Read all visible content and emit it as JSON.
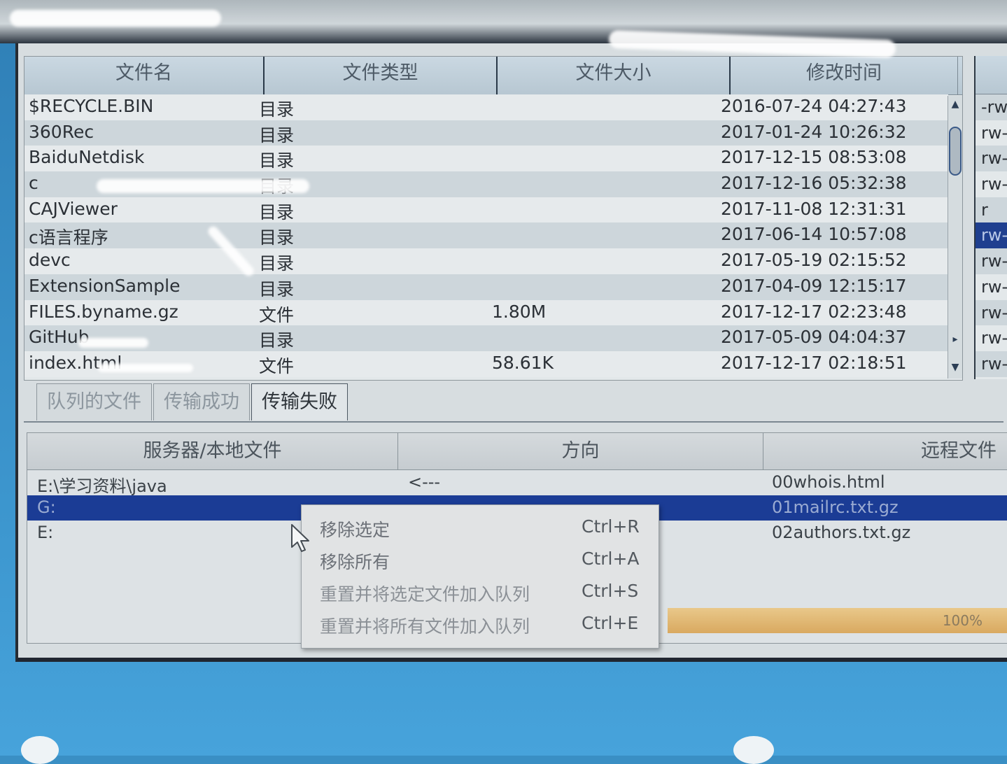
{
  "file_list": {
    "headers": [
      "文件名",
      "文件类型",
      "文件大小",
      "修改时间"
    ],
    "rows": [
      {
        "name": "$RECYCLE.BIN",
        "type": "目录",
        "size": "",
        "time": "2016-07-24  04:27:43"
      },
      {
        "name": "360Rec",
        "type": "目录",
        "size": "",
        "time": "2017-01-24  10:26:32"
      },
      {
        "name": "BaiduNetdisk",
        "type": "目录",
        "size": "",
        "time": "2017-12-15  08:53:08"
      },
      {
        "name": "c",
        "type": "目录",
        "size": "",
        "time": "2017-12-16  05:32:38"
      },
      {
        "name": "CAJViewer",
        "type": "目录",
        "size": "",
        "time": "2017-11-08  12:31:31"
      },
      {
        "name": "c语言程序",
        "type": "目录",
        "size": "",
        "time": "2017-06-14  10:57:08"
      },
      {
        "name": "devc",
        "type": "目录",
        "size": "",
        "time": "2017-05-19  02:15:52"
      },
      {
        "name": "ExtensionSample",
        "type": "目录",
        "size": "",
        "time": "2017-04-09  12:15:17"
      },
      {
        "name": "FILES.byname.gz",
        "type": "文件",
        "size": "1.80M",
        "time": "2017-12-17  02:23:48"
      },
      {
        "name": "GitHub",
        "type": "目录",
        "size": "",
        "time": "2017-05-09  04:04:37"
      },
      {
        "name": "index.html",
        "type": "文件",
        "size": "58.61K",
        "time": "2017-12-17  02:18:51"
      }
    ]
  },
  "permissions": [
    "-rw",
    "rw-",
    "rw-",
    "rw-",
    "r",
    "rw-",
    "rw-",
    "rw-",
    "rw-",
    "rw-",
    "rw-"
  ],
  "tabs": [
    "队列的文件",
    "传输成功",
    "传输失败"
  ],
  "queue": {
    "headers": [
      "服务器/本地文件",
      "方向",
      "远程文件"
    ],
    "rows": [
      {
        "local": "E:\\学习资料\\java",
        "direction": "<---",
        "remote": "00whois.html"
      },
      {
        "local": "G:",
        "direction": "",
        "remote": "01mailrc.txt.gz"
      },
      {
        "local": "E:",
        "direction": "",
        "remote": "02authors.txt.gz"
      }
    ],
    "progress_label": "100%"
  },
  "context_menu": [
    {
      "label": "移除选定",
      "shortcut": "Ctrl+R"
    },
    {
      "label": "移除所有",
      "shortcut": "Ctrl+A"
    },
    {
      "label": "重置并将选定文件加入队列",
      "shortcut": "Ctrl+S"
    },
    {
      "label": "重置并将所有文件加入队列",
      "shortcut": "Ctrl+E"
    }
  ],
  "colors": {
    "selection": "#1b3c95",
    "bezel": "#3a8fc4"
  }
}
